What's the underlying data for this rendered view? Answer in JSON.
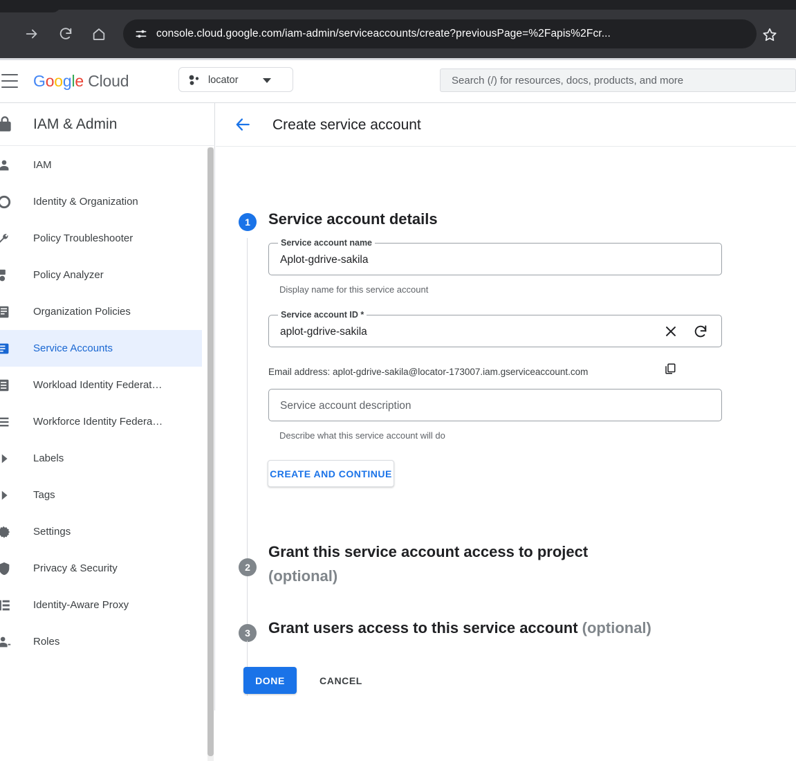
{
  "browser": {
    "url": "console.cloud.google.com/iam-admin/serviceaccounts/create?previousPage=%2Fapis%2Fcr...",
    "forward_icon": "arrow-forward-icon",
    "reload_icon": "reload-icon",
    "home_icon": "home-icon",
    "site_settings_icon": "tune-icon",
    "bookmark_icon": "star-outline-icon"
  },
  "header": {
    "menu_icon": "hamburger-menu-icon",
    "brand": {
      "g1": "G",
      "g2": "o",
      "g3": "o",
      "g4": "g",
      "g5": "l",
      "g6": "e",
      "cloud": " Cloud"
    },
    "project": {
      "name": "locator",
      "icon": "project-dots-icon",
      "caret": "chevron-down-icon"
    },
    "search": {
      "placeholder": "Search (/) for resources, docs, products, and more",
      "icon": "search-icon"
    }
  },
  "sidebar": {
    "title": "IAM & Admin",
    "product_icon": "iam-admin-icon",
    "items": [
      {
        "label": "IAM",
        "icon": "person-icon",
        "selected": false
      },
      {
        "label": "Identity & Organization",
        "icon": "organization-icon",
        "selected": false
      },
      {
        "label": "Policy Troubleshooter",
        "icon": "wrench-icon",
        "selected": false
      },
      {
        "label": "Policy Analyzer",
        "icon": "analyzer-icon",
        "selected": false
      },
      {
        "label": "Organization Policies",
        "icon": "policy-icon",
        "selected": false
      },
      {
        "label": "Service Accounts",
        "icon": "service-account-icon",
        "selected": true
      },
      {
        "label": "Workload Identity Federat…",
        "icon": "workload-identity-icon",
        "selected": false
      },
      {
        "label": "Workforce Identity Federa…",
        "icon": "workforce-identity-icon",
        "selected": false
      },
      {
        "label": "Labels",
        "icon": "chevron-right-icon",
        "selected": false
      },
      {
        "label": "Tags",
        "icon": "chevron-right-icon",
        "selected": false
      },
      {
        "label": "Settings",
        "icon": "settings-icon",
        "selected": false
      },
      {
        "label": "Privacy & Security",
        "icon": "privacy-icon",
        "selected": false
      },
      {
        "label": "Identity-Aware Proxy",
        "icon": "iap-icon",
        "selected": false
      },
      {
        "label": "Roles",
        "icon": "roles-icon",
        "selected": false
      }
    ]
  },
  "page": {
    "back_icon": "arrow-back-icon",
    "title": "Create service account"
  },
  "steps": {
    "step1": {
      "number": "1",
      "heading": "Service account details",
      "name_field": {
        "label": "Service account name",
        "value": "Aplot-gdrive-sakila",
        "helper": "Display name for this service account"
      },
      "id_field": {
        "label": "Service account ID *",
        "value": "aplot-gdrive-sakila",
        "clear_icon": "close-icon",
        "refresh_icon": "refresh-icon"
      },
      "email": {
        "text": "Email address: aplot-gdrive-sakila@locator-173007.iam.gserviceaccount.com",
        "copy_icon": "copy-icon"
      },
      "description_field": {
        "placeholder": "Service account description",
        "value": "",
        "helper": "Describe what this service account will do"
      },
      "primary_button": "CREATE AND CONTINUE"
    },
    "step2": {
      "number": "2",
      "heading_line1": "Grant this service account access to project",
      "heading_line2": "(optional)"
    },
    "step3": {
      "number": "3",
      "heading": "Grant users access to this service account",
      "optional": "(optional)"
    }
  },
  "actions": {
    "done": "DONE",
    "cancel": "CANCEL"
  },
  "colors": {
    "accent": "#1a73e8",
    "selected_bg": "#e8f0fe",
    "selected_text": "#1967d2",
    "muted_text": "#5f6368",
    "chrome_bg": "#35363a"
  }
}
